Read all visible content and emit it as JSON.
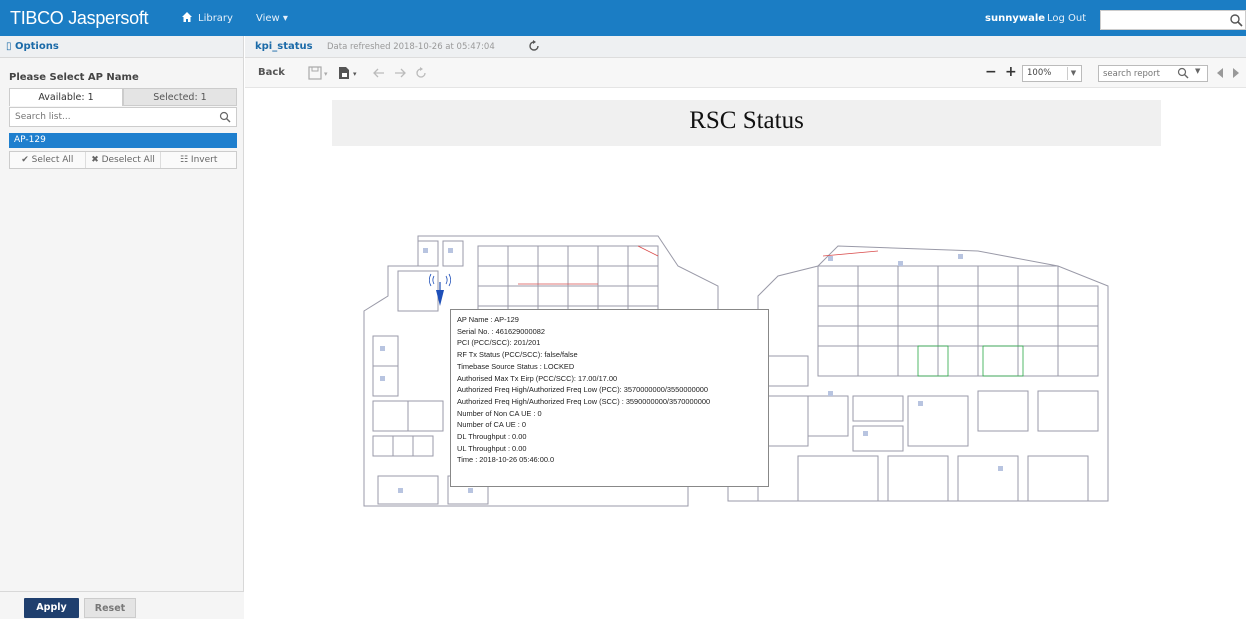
{
  "topbar": {
    "logo": "TIBCO Jaspersoft",
    "library_label": "Library",
    "view_label": "View ▾",
    "user": "sunnywale",
    "logout_label": "Log Out",
    "search_value": "",
    "icons": {
      "home": "home-icon",
      "search": "search-icon"
    },
    "color": "#1b7dc4"
  },
  "left_panel": {
    "header": "Options",
    "select_label": "Please Select AP Name",
    "tabs": [
      {
        "label": "Available: 1",
        "active": true
      },
      {
        "label": "Selected: 1",
        "active": false
      }
    ],
    "search_placeholder": "Search list...",
    "items": [
      {
        "label": "AP-129",
        "selected": true
      }
    ],
    "actions": [
      {
        "label": "✔ Select All"
      },
      {
        "label": "✖ Deselect All"
      },
      {
        "label": "☷ Invert"
      }
    ],
    "apply_label": "Apply",
    "reset_label": "Reset"
  },
  "report": {
    "name": "kpi_status",
    "refreshed": "Data refreshed 2018-10-26 at 05:47:04",
    "back_label": "Back",
    "zoom": "100%",
    "search_placeholder": "search report",
    "title": "RSC Status"
  },
  "tooltip": {
    "lines": [
      "AP Name : AP-129",
      "Serial No. : 461629000082",
      "PCI (PCC/SCC): 201/201",
      "RF Tx Status (PCC/SCC): false/false",
      "Timebase Source Status : LOCKED",
      "Authorised Max Tx Eirp (PCC/SCC): 17.00/17.00",
      "Authorized Freq High/Authorized Freq Low (PCC): 3570000000/3550000000",
      "Authorized Freq High/Authorized Freq Low (SCC) : 3590000000/3570000000",
      "Number of Non CA UE : 0",
      "Number of CA UE : 0",
      "DL Throughput : 0.00",
      "UL Throughput : 0.00",
      "Time : 2018-10-26 05:46:00.0"
    ]
  }
}
